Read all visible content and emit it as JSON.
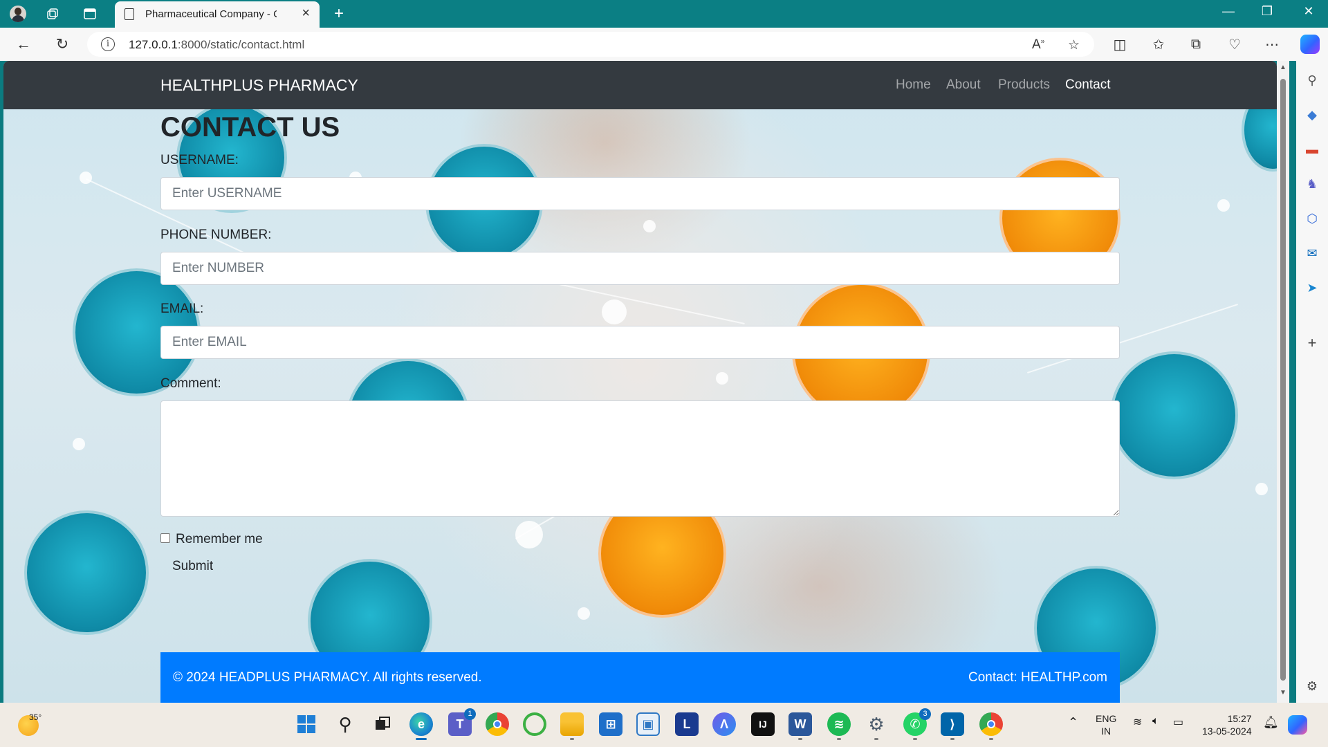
{
  "browser": {
    "tab_title": "Pharmaceutical Company - Contact",
    "url_host": "127.0.0.1",
    "url_path": ":8000/static/contact.html"
  },
  "site": {
    "brand": "HEALTHPLUS PHARMACY",
    "nav": [
      "Home",
      "About",
      "Products",
      "Contact"
    ],
    "active_nav": "Contact"
  },
  "form": {
    "heading": "CONTACT US",
    "username_label": "USERNAME:",
    "username_placeholder": "Enter USERNAME",
    "phone_label": "PHONE NUMBER:",
    "phone_placeholder": "Enter NUMBER",
    "email_label": "EMAIL:",
    "email_placeholder": "Enter EMAIL",
    "comment_label": "Comment:",
    "remember_label": "Remember me",
    "submit_label": "Submit"
  },
  "footer": {
    "copyright": "© 2024 HEADPLUS PHARMACY. All rights reserved.",
    "contact": "Contact: HEALTHP.com"
  },
  "taskbar": {
    "weather_temp": "35°",
    "teams_badge": "1",
    "whatsapp_badge": "3",
    "language": "ENG",
    "region": "IN",
    "time": "15:27",
    "date": "13-05-2024"
  },
  "colors": {
    "navbar": "#343a40",
    "footer": "#007bff",
    "titlebar": "#0b7f84"
  }
}
